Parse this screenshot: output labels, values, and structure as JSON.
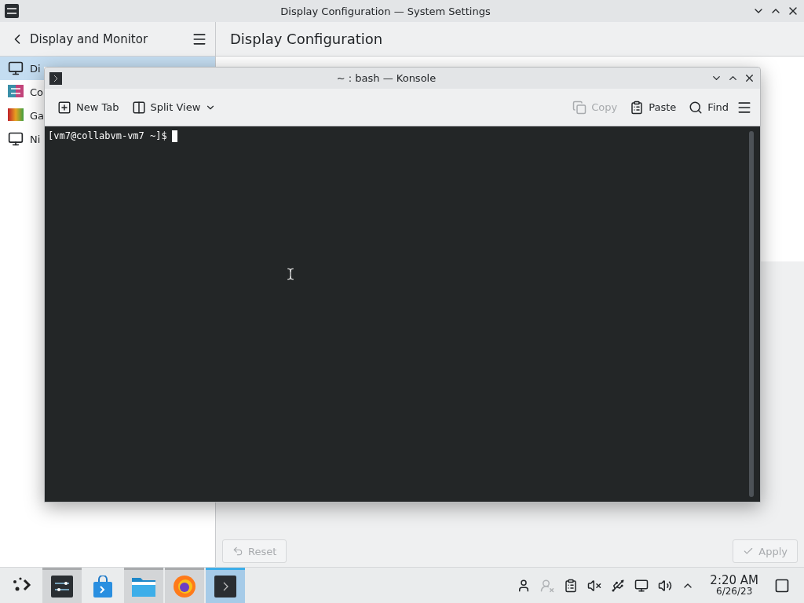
{
  "settings_window": {
    "title": "Display Configuration — System Settings",
    "sidebar_header": "Display and Monitor",
    "page_title": "Display Configuration",
    "sidebar_items": [
      {
        "label": "Di",
        "kind": "monitor",
        "selected": true
      },
      {
        "label": "Co",
        "kind": "color",
        "selected": false
      },
      {
        "label": "Ga",
        "kind": "gamma",
        "selected": false
      },
      {
        "label": "Ni",
        "kind": "monitor",
        "selected": false
      }
    ],
    "footer_buttons": [
      {
        "label": "Reset",
        "kind": "reset",
        "disabled": true
      },
      {
        "label": "Apply",
        "kind": "apply",
        "disabled": true
      }
    ]
  },
  "konsole": {
    "title": "~ : bash — Konsole",
    "toolbar": [
      {
        "label": "New Tab",
        "kind": "new-tab",
        "disabled": false
      },
      {
        "label": "Split View",
        "kind": "split-view",
        "disabled": false
      },
      {
        "label": "Copy",
        "kind": "copy",
        "disabled": true
      },
      {
        "label": "Paste",
        "kind": "paste",
        "disabled": false
      },
      {
        "label": "Find",
        "kind": "find",
        "disabled": false
      }
    ],
    "prompt": "[vm7@collabvm-vm7 ~]$"
  },
  "taskbar": {
    "apps": [
      {
        "kind": "settings",
        "open": true,
        "selected": false
      },
      {
        "kind": "store",
        "open": false,
        "selected": false
      },
      {
        "kind": "files",
        "open": true,
        "selected": false
      },
      {
        "kind": "browser",
        "open": true,
        "selected": false
      },
      {
        "kind": "terminal",
        "open": true,
        "selected": true
      }
    ],
    "time": "2:20 AM",
    "date": "6/26/23"
  }
}
